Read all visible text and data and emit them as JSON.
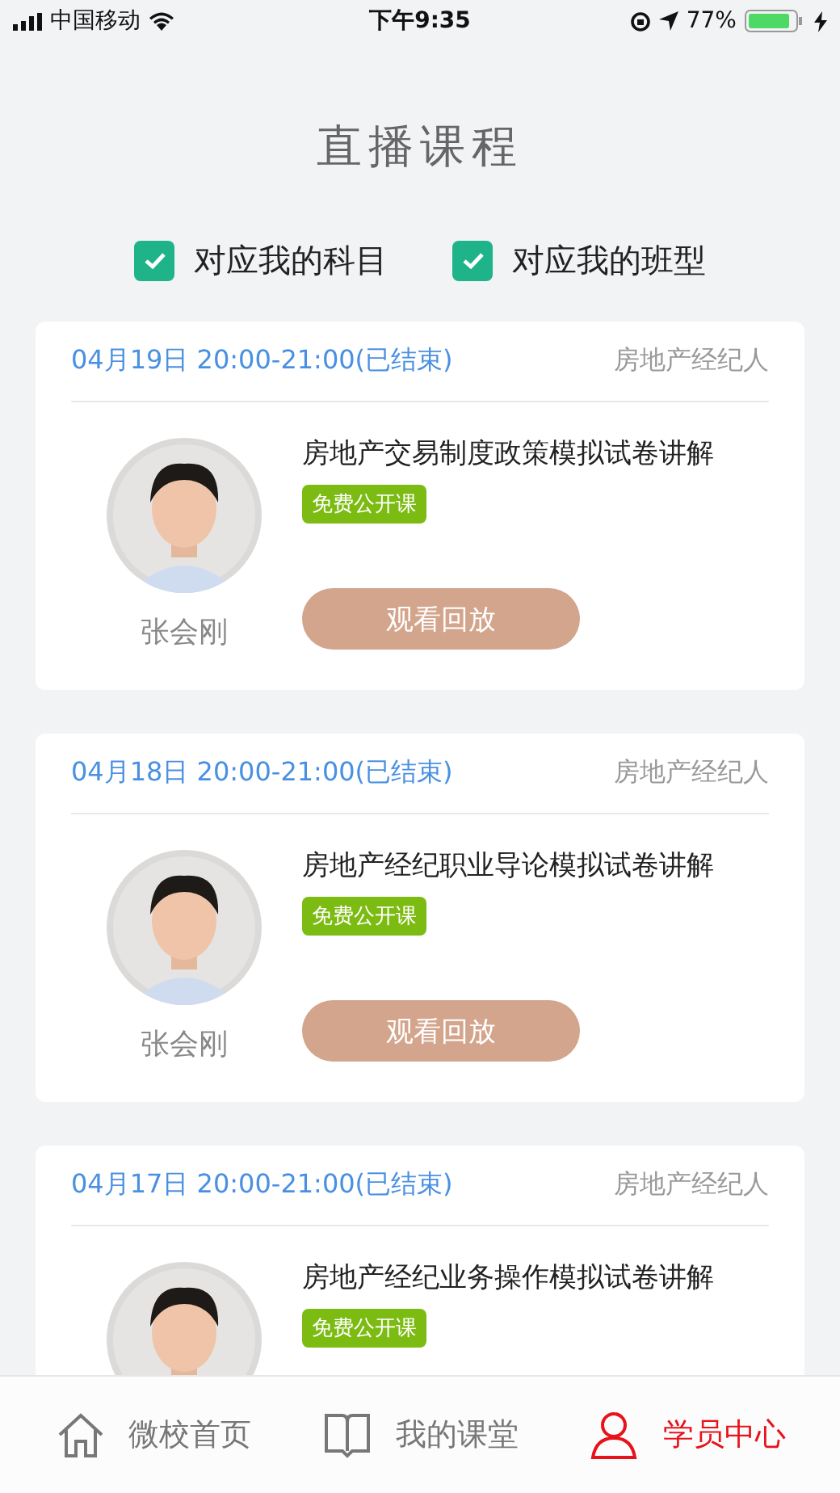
{
  "status_bar": {
    "carrier": "中国移动",
    "time": "下午9:35",
    "battery": "77%"
  },
  "header": {
    "title": "直播课程"
  },
  "filters": [
    {
      "label": "对应我的科目",
      "checked": true
    },
    {
      "label": "对应我的班型",
      "checked": true
    }
  ],
  "courses": [
    {
      "time": "04月19日 20:00-21:00(已结束)",
      "category": "房地产经纪人",
      "title": "房地产交易制度政策模拟试卷讲解",
      "tag": "免费公开课",
      "teacher": "张会刚",
      "button": "观看回放"
    },
    {
      "time": "04月18日 20:00-21:00(已结束)",
      "category": "房地产经纪人",
      "title": "房地产经纪职业导论模拟试卷讲解",
      "tag": "免费公开课",
      "teacher": "张会刚",
      "button": "观看回放"
    },
    {
      "time": "04月17日 20:00-21:00(已结束)",
      "category": "房地产经纪人",
      "title": "房地产经纪业务操作模拟试卷讲解",
      "tag": "免费公开课"
    }
  ],
  "tab_bar": [
    {
      "kind": "home",
      "label": "微校首页",
      "selected": false
    },
    {
      "kind": "book",
      "label": "我的课堂",
      "selected": false
    },
    {
      "kind": "user",
      "label": "学员中心",
      "selected": true
    }
  ]
}
